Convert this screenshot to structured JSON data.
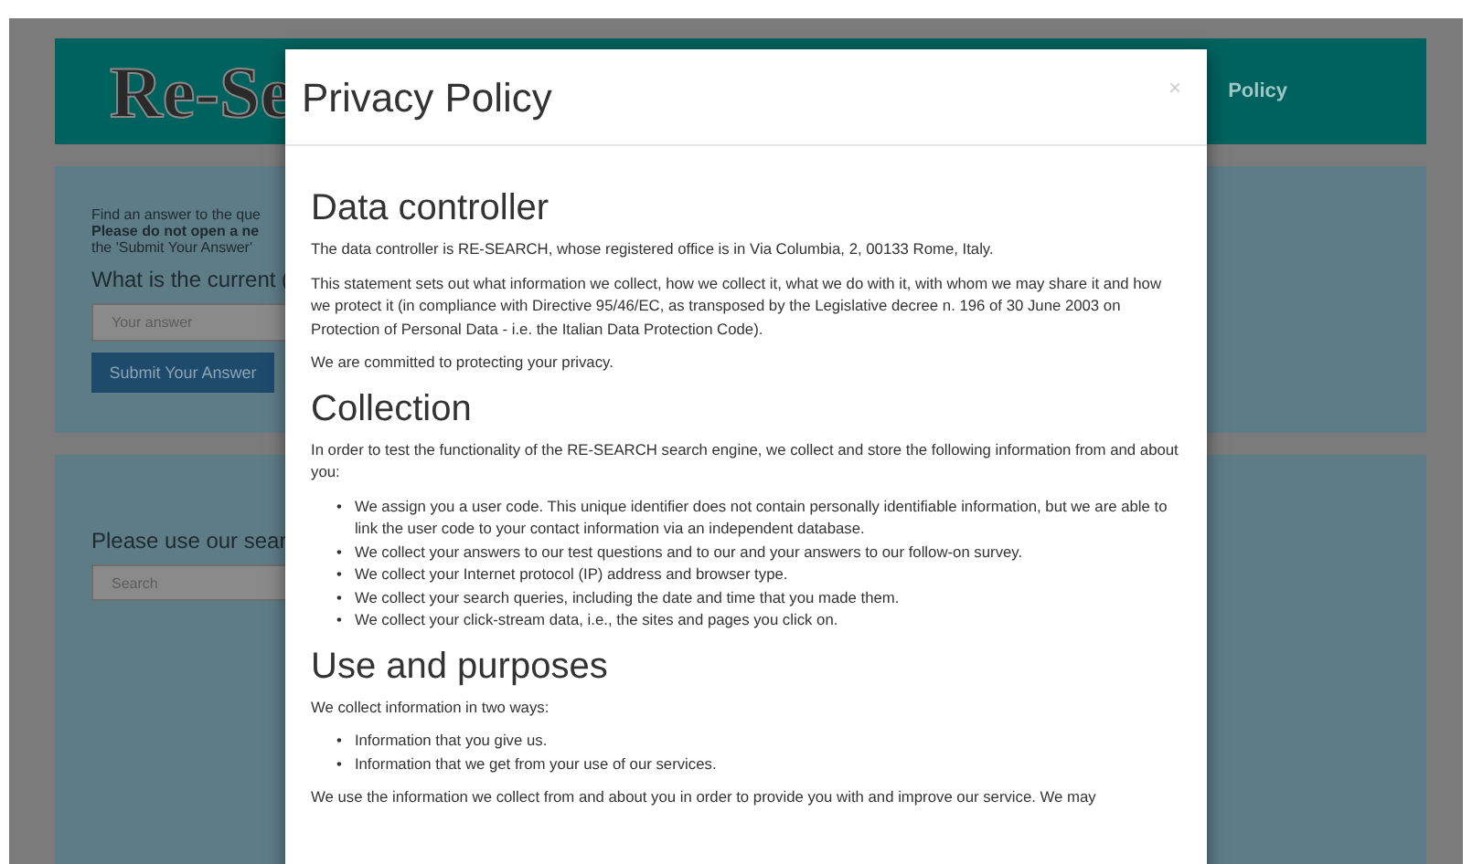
{
  "site": {
    "logo": "Re-Se",
    "nav_link": "Policy",
    "question_panel": {
      "lines": [
        "Find an answer to the que",
        "Please do not open a ne",
        "the 'Submit Your Answer'"
      ],
      "question": "What is the current (",
      "answer_placeholder": "Your answer",
      "submit": "Submit Your Answer"
    },
    "search_panel": {
      "prompt": "Please use our sear",
      "search_placeholder": "Search"
    }
  },
  "modal": {
    "title": "Privacy Policy",
    "close": "×",
    "sections": [
      {
        "heading": "Data controller",
        "blocks": [
          {
            "kind": "paragraph",
            "text": "The data controller is RE-SEARCH, whose registered office is in Via Columbia, 2, 00133 Rome, Italy."
          },
          {
            "kind": "paragraph",
            "text": "This statement sets out what information we collect, how we collect it, what we do with it, with whom we may share it and how we protect it (in compliance with Directive 95/46/EC, as transposed by the Legislative decree n. 196 of 30 June 2003 on Protection of Personal Data - i.e. the Italian Data Protection Code)."
          },
          {
            "kind": "paragraph",
            "text": "We are committed to protecting your privacy."
          }
        ]
      },
      {
        "heading": "Collection",
        "blocks": [
          {
            "kind": "paragraph",
            "text": "In order to test the functionality of the RE-SEARCH search engine, we collect and store the following information from and about you:"
          },
          {
            "kind": "list",
            "marker": "•",
            "items": [
              "We assign you a user code. This unique identifier does not contain personally identifiable information, but we are able to link the user code to your contact information via an independent database.",
              "We collect your answers to our test questions and to our and your answers to our follow-on survey.",
              "We collect your Internet protocol (IP) address and browser type.",
              "We collect your search queries, including the date and time that you made them.",
              "We collect your click-stream data, i.e., the sites and pages you click on."
            ]
          }
        ]
      },
      {
        "heading": "Use and purposes",
        "blocks": [
          {
            "kind": "paragraph",
            "text": "We collect information in two ways:"
          },
          {
            "kind": "list",
            "marker": "•",
            "items": [
              "Information that you give us.",
              "Information that we get from your use of our services."
            ]
          },
          {
            "kind": "paragraph",
            "text": "We use the information we collect from and about you in order to provide you with and improve our service. We may"
          }
        ]
      }
    ]
  }
}
